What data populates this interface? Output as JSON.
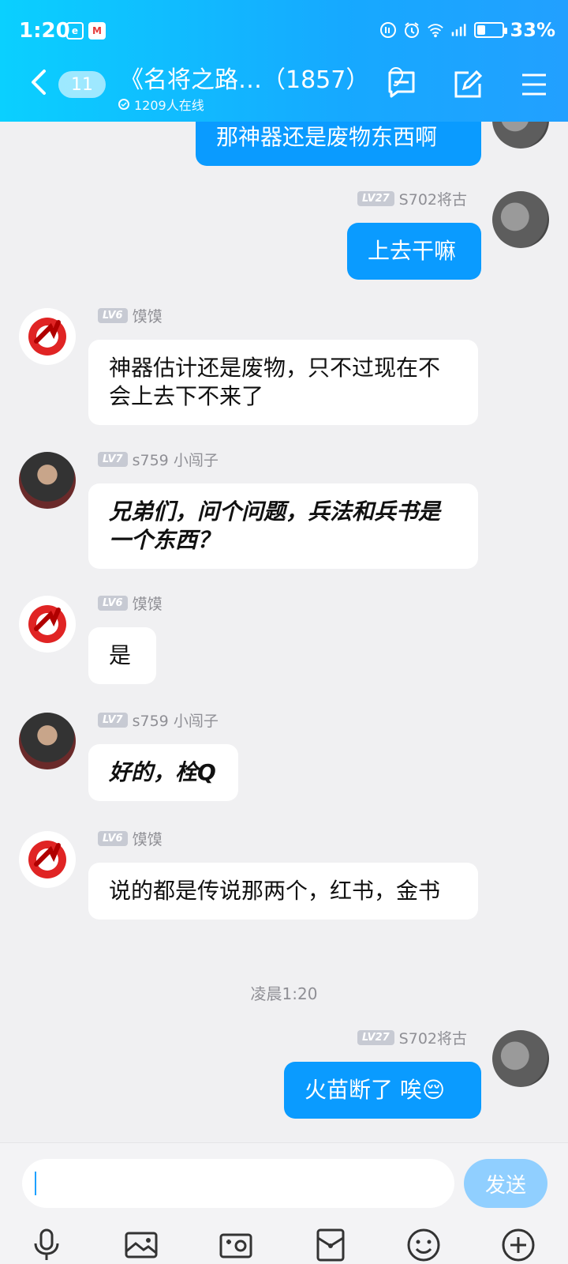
{
  "status_bar": {
    "time": "1:20",
    "battery_percent": "33%",
    "battery_level": 0.33
  },
  "header": {
    "back_count": "11",
    "group_name": "《名将之路…（1857）",
    "online_text": "1209人在线",
    "icons": [
      "chevron-left-icon",
      "ear-icon",
      "chat-bubble-icon",
      "edit-icon",
      "menu-icon"
    ]
  },
  "messages": [
    {
      "side": "me",
      "text": "那神器还是废物东西啊"
    },
    {
      "side": "me",
      "level": "LV27",
      "sender": "S702将古",
      "text": "上去干嘛"
    },
    {
      "side": "them",
      "level": "LV6",
      "sender": "馍馍",
      "text": "神器估计还是废物，只不过现在不会上去下不来了"
    },
    {
      "side": "them",
      "level": "LV7",
      "sender": "s759 小闯子",
      "text": "兄弟们，问个问题，兵法和兵书是一个东西？"
    },
    {
      "side": "them",
      "level": "LV6",
      "sender": "馍馍",
      "text": "是"
    },
    {
      "side": "them",
      "level": "LV7",
      "sender": "s759 小闯子",
      "text": "好的，栓Q"
    },
    {
      "side": "them",
      "level": "LV6",
      "sender": "馍馍",
      "text": "说的都是传说那两个，红书，金书"
    },
    {
      "time_chip": "凌晨1:20"
    },
    {
      "side": "me",
      "level": "LV27",
      "sender": "S702将古",
      "text": "火苗断了  唉",
      "emoji": "😔"
    }
  ],
  "input": {
    "value": "",
    "send_label": "发送"
  },
  "toolbar": {
    "icons": [
      "microphone-icon",
      "image-icon",
      "camera-icon",
      "red-packet-icon",
      "emoji-icon",
      "plus-icon"
    ]
  },
  "colors": {
    "header_start": "#0ad0ff",
    "header_end": "#22a0ff",
    "my_bubble": "#0a9bff",
    "send_button": "#90cfff",
    "background": "#f0f0f2"
  }
}
